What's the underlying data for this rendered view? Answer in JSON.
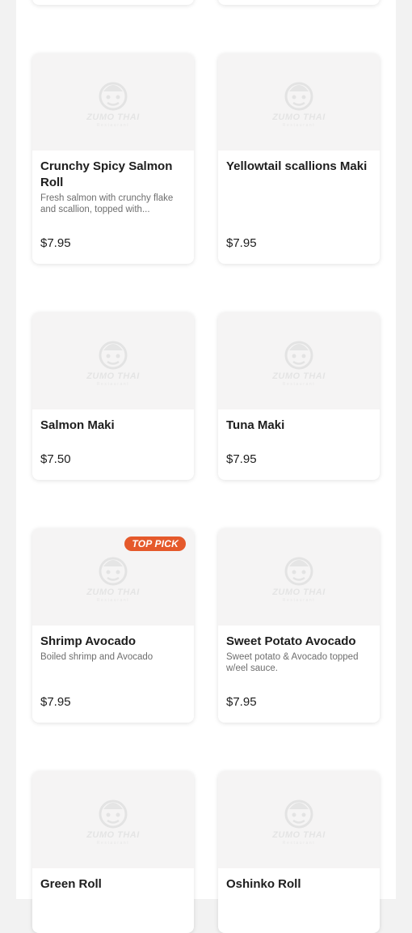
{
  "logo": {
    "word": "ZUMO THAI",
    "sub": "Restaurant"
  },
  "items": [
    {
      "name": "Crunchy Spicy Salmon Roll",
      "desc": "Fresh salmon with crunchy flake and scallion, topped with...",
      "price": "$7.95"
    },
    {
      "name": "Yellowtail scallions Maki",
      "desc": "",
      "price": "$7.95"
    },
    {
      "name": "Salmon Maki",
      "desc": "",
      "price": "$7.50"
    },
    {
      "name": "Tuna Maki",
      "desc": "",
      "price": "$7.95"
    },
    {
      "name": "Shrimp Avocado",
      "desc": "Boiled shrimp and Avocado",
      "price": "$7.95",
      "badge": "TOP PICK"
    },
    {
      "name": "Sweet Potato Avocado",
      "desc": "Sweet potato & Avocado topped w/eel sauce.",
      "price": "$7.95"
    },
    {
      "name": "Green Roll",
      "desc": "",
      "price": ""
    },
    {
      "name": "Oshinko Roll",
      "desc": "",
      "price": ""
    }
  ],
  "colors": {
    "badge": "#e5592b",
    "card_image_bg": "#f5f4f4"
  }
}
